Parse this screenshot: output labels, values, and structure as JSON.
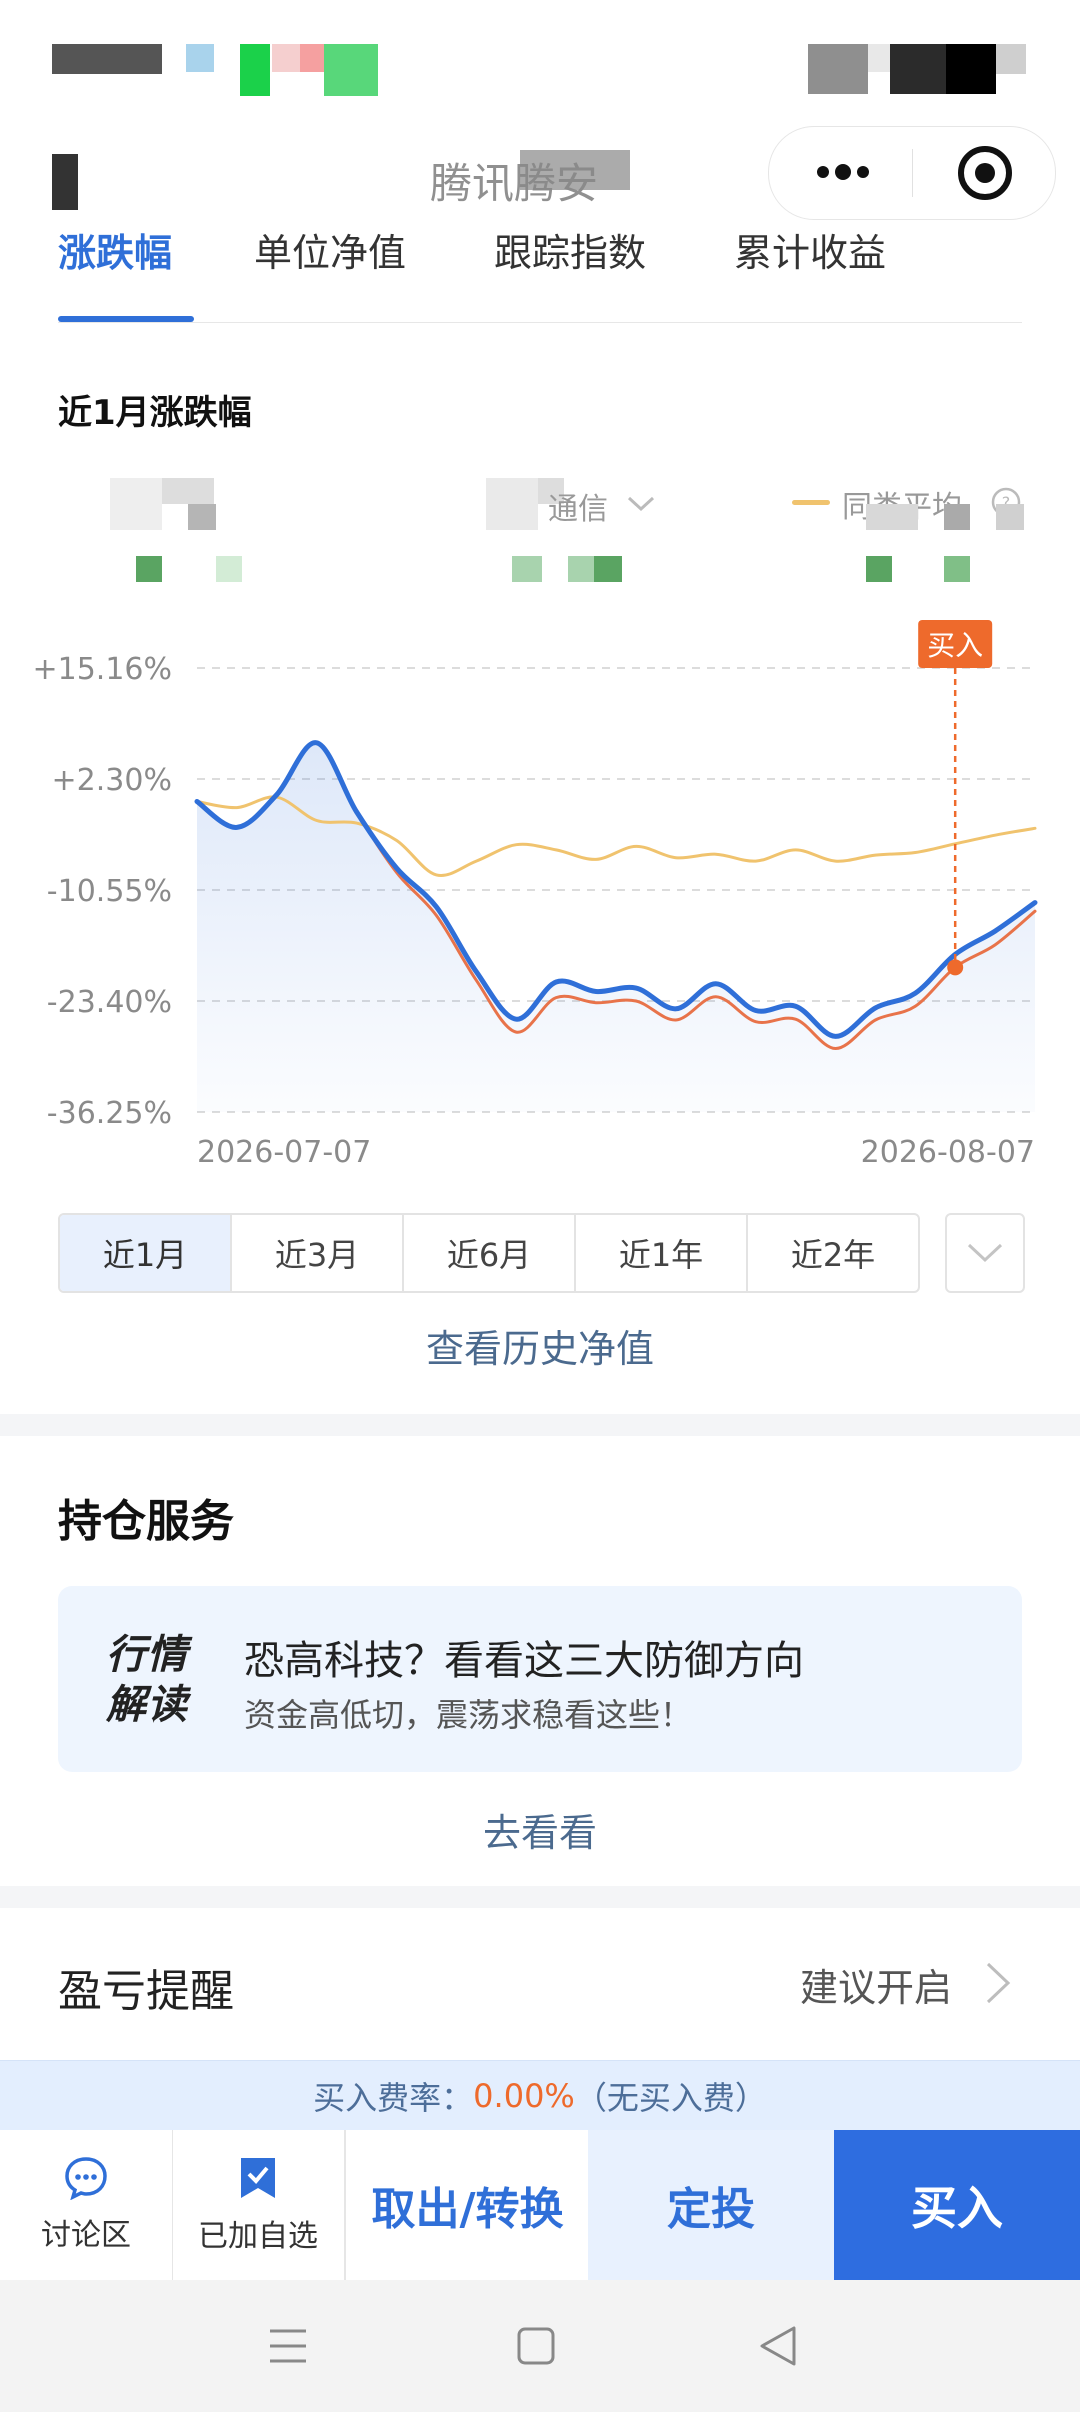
{
  "header": {
    "title_visible_fragment": "腾讯腾安"
  },
  "tabs": [
    {
      "label": "涨跌幅",
      "active": true
    },
    {
      "label": "单位净值",
      "active": false
    },
    {
      "label": "跟踪指数",
      "active": false
    },
    {
      "label": "累计收益",
      "active": false
    }
  ],
  "chart_section": {
    "title": "近1月涨跌幅",
    "legend": {
      "middle_fragment": "通信",
      "right_label": "同类平均"
    }
  },
  "chart_data": {
    "type": "line",
    "x": [
      "2026-07-07",
      "2026-08-07"
    ],
    "y_ticks": [
      "+15.16%",
      "+2.30%",
      "-10.55%",
      "-23.40%",
      "-36.25%"
    ],
    "ylim": [
      -36.25,
      15.16
    ],
    "series": [
      {
        "color": "#2f6fd8",
        "values": [
          -0.3,
          -3.3,
          0.5,
          6.5,
          -1.5,
          -8.0,
          -12.5,
          -20.0,
          -25.5,
          -21.2,
          -22.3,
          -21.9,
          -24.3,
          -21.4,
          -24.5,
          -24.0,
          -27.5,
          -24.2,
          -22.5,
          -18.0,
          -15.3,
          -12.0
        ]
      },
      {
        "color": "#e8734a",
        "values": [
          -0.3,
          -3.3,
          0.5,
          6.5,
          -1.5,
          -8.5,
          -13.5,
          -21.0,
          -27.0,
          -23.0,
          -23.6,
          -23.4,
          -25.6,
          -22.9,
          -25.8,
          -25.5,
          -28.9,
          -25.6,
          -24.0,
          -19.5,
          -16.9,
          -13.0
        ]
      },
      {
        "color": "#f0c36e",
        "values": [
          -0.3,
          -1.0,
          0.2,
          -2.5,
          -2.8,
          -4.8,
          -8.8,
          -7.2,
          -5.3,
          -5.9,
          -7.0,
          -5.5,
          -6.8,
          -6.4,
          -7.2,
          -5.9,
          -7.2,
          -6.5,
          -6.2,
          -5.2,
          -4.2,
          -3.4
        ]
      }
    ],
    "marker": {
      "label": "买入",
      "series_index": 1,
      "point_index": 19
    }
  },
  "periods": [
    {
      "label": "近1月",
      "selected": true
    },
    {
      "label": "近3月",
      "selected": false
    },
    {
      "label": "近6月",
      "selected": false
    },
    {
      "label": "近1年",
      "selected": false
    },
    {
      "label": "近2年",
      "selected": false
    }
  ],
  "history_link": "查看历史净值",
  "holding": {
    "title": "持仓服务",
    "badge": "行情解读",
    "promo_title": "恐高科技？看看这三大防御方向",
    "promo_sub": "资金高低切，震荡求稳看这些！",
    "go_label": "去看看"
  },
  "profit_alert": {
    "title": "盈亏提醒",
    "value": "建议开启"
  },
  "fee": {
    "prefix": "买入费率：",
    "rate": "0.00%",
    "suffix": "（无买入费）"
  },
  "actions": {
    "discuss": "讨论区",
    "watchlist": "已加自选",
    "redeem": "取出/转换",
    "plan": "定投",
    "buy": "买入"
  },
  "colors": {
    "accent": "#2f6fd8",
    "orange": "#ee6a2c",
    "average_line": "#f0c36e"
  }
}
